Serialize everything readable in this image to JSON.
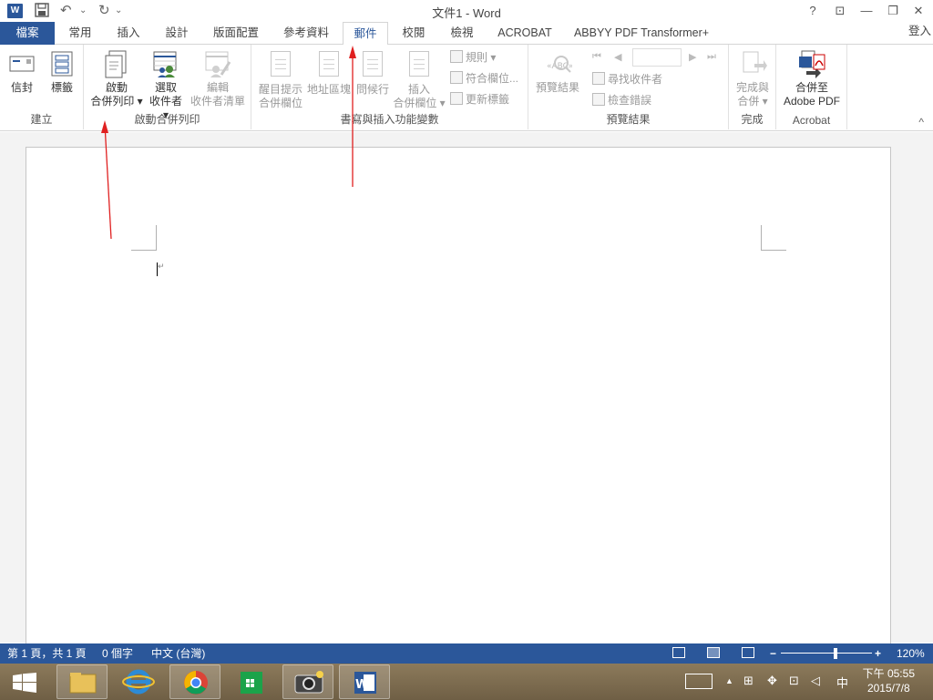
{
  "window": {
    "title": "文件1 - Word",
    "help": "?",
    "ribbon_display": "⊡",
    "minimize": "—",
    "restore": "❐",
    "close": "✕"
  },
  "quick_access": {
    "save": "💾",
    "undo": "↶",
    "undo_dd": "⌄",
    "redo": "↻",
    "redo_dd": "⌄",
    "app_letter": "W"
  },
  "tabs": [
    {
      "label": "檔案"
    },
    {
      "label": "常用"
    },
    {
      "label": "插入"
    },
    {
      "label": "設計"
    },
    {
      "label": "版面配置"
    },
    {
      "label": "參考資料"
    },
    {
      "label": "郵件"
    },
    {
      "label": "校閱"
    },
    {
      "label": "檢視"
    },
    {
      "label": "ACROBAT"
    },
    {
      "label": "ABBYY PDF Transformer+"
    }
  ],
  "login": "登入",
  "ribbon": {
    "create": {
      "label": "建立",
      "envelope": "信封",
      "labels": "標籤"
    },
    "start_merge": {
      "label": "啟動合併列印",
      "start_l1": "啟動",
      "start_l2": "合併列印 ▾",
      "select_l1": "選取",
      "select_l2": "收件者 ▾",
      "edit_l1": "編輯",
      "edit_l2": "收件者清單"
    },
    "write_insert": {
      "label": "書寫與插入功能變數",
      "highlight_l1": "醒目提示",
      "highlight_l2": "合併欄位",
      "address": "地址區塊",
      "greeting": "問候行",
      "insert_l1": "插入",
      "insert_l2": "合併欄位 ▾",
      "rules": "規則 ▾",
      "match": "符合欄位...",
      "update": "更新標籤"
    },
    "preview": {
      "label": "預覽結果",
      "preview_btn": "預覽結果",
      "find": "尋找收件者",
      "check": "檢查錯誤"
    },
    "finish": {
      "label": "完成",
      "finish_l1": "完成與",
      "finish_l2": "合併 ▾"
    },
    "acrobat": {
      "label": "Acrobat",
      "merge_l1": "合併至",
      "merge_l2": "Adobe PDF"
    },
    "collapse": "^"
  },
  "document": {
    "paragraph_mark": "↵"
  },
  "status": {
    "page": "第 1 頁，共 1 頁",
    "words": "0 個字",
    "language": "中文 (台灣)",
    "zoom_minus": "−",
    "zoom_plus": "+",
    "zoom_level": "120%",
    "zoom_fraction": 0.6
  },
  "taskbar": {
    "tray_up": "▲",
    "ime": "中",
    "time": "下午 05:55",
    "date": "2015/7/8"
  }
}
